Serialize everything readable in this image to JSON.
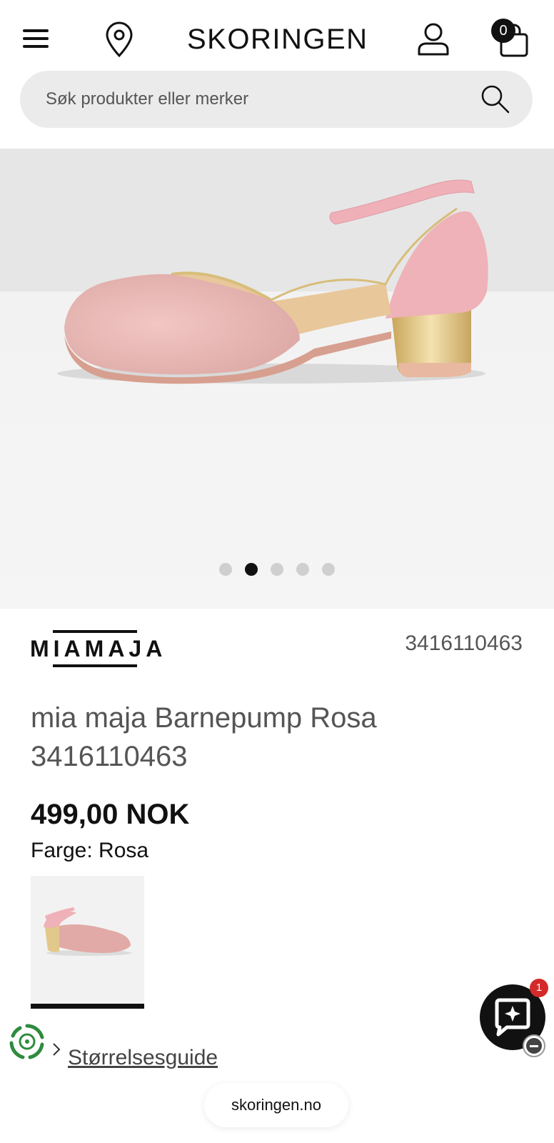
{
  "header": {
    "logo_text": "SKORINGEN",
    "cart_count": "0",
    "icons": {
      "menu": "hamburger-menu-icon",
      "location": "location-pin-icon",
      "account": "user-icon",
      "cart": "shopping-bag-icon"
    }
  },
  "search": {
    "placeholder": "Søk produkter eller merker",
    "icon": "search-icon"
  },
  "gallery": {
    "image_count": 5,
    "active_index": 1
  },
  "product": {
    "brand_logo_text": "MIAMAJA",
    "sku": "3416110463",
    "title": "mia maja Barnepump Rosa 3416110463",
    "price": "499,00 NOK",
    "color_label": "Farge: Rosa"
  },
  "size_guide": {
    "label": "Størrelsesguide",
    "eco_icon": "recycle-icon"
  },
  "chat": {
    "badge_count": "1",
    "icon": "chat-sparkle-icon"
  },
  "browser": {
    "url": "skoringen.no"
  },
  "colors": {
    "text": "#111111",
    "muted": "#555555",
    "search_bg": "#ebebeb",
    "badge_red": "#d42a2a",
    "shoe_pink": "#eeb2b8",
    "heel_gold": "#e2c98b"
  }
}
